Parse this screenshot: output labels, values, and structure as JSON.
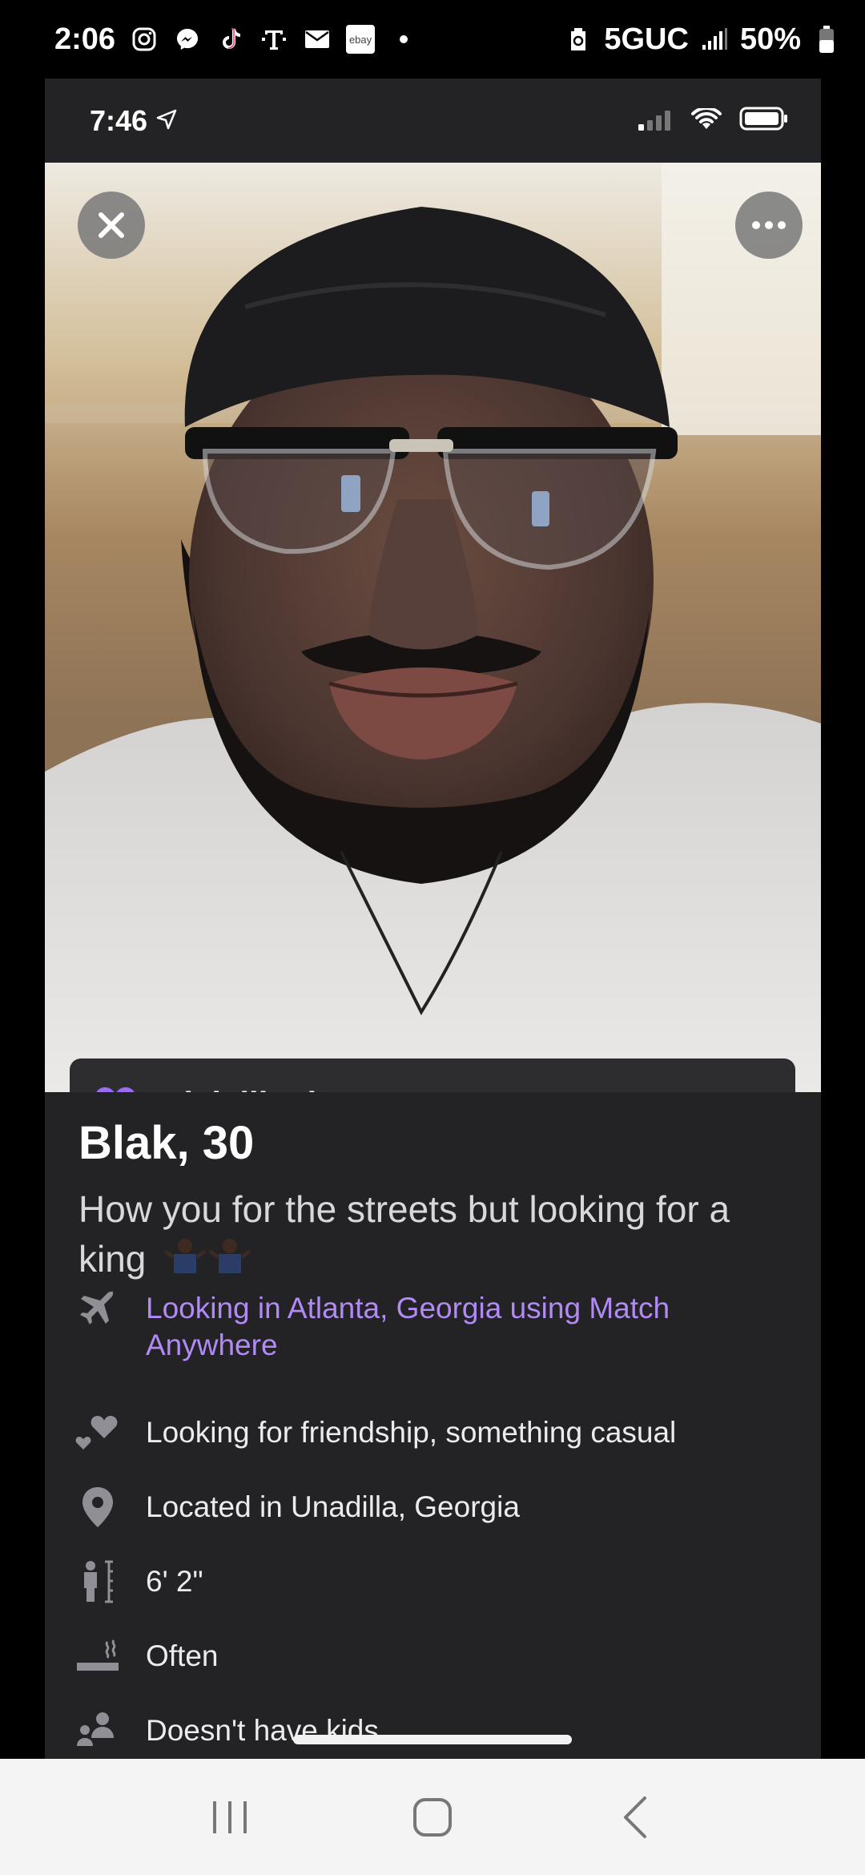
{
  "android_status": {
    "time": "2:06",
    "network": "5GUC",
    "battery": "50%",
    "notification_icons": [
      "instagram-icon",
      "messenger-icon",
      "tiktok-icon",
      "tmobile-icon",
      "mail-icon",
      "ebay-icon",
      "dot-icon"
    ],
    "ebay_label": "ebay"
  },
  "ios_status": {
    "time": "7:46"
  },
  "photo": {
    "liked_banner": "Blak liked you",
    "accent_color": "#9b6cf0"
  },
  "profile": {
    "name_age": "Blak, 30",
    "tagline": "How you for the streets but looking for a king",
    "tagline_emoji": "🤷🏿‍♂️ 🤷🏿‍♂️",
    "details": [
      {
        "icon": "airplane-icon",
        "text": "Looking in Atlanta, Georgia using Match Anywhere",
        "accent": true
      },
      {
        "icon": "hearts-icon",
        "text": "Looking for friendship, something casual",
        "accent": false
      },
      {
        "icon": "location-pin-icon",
        "text": "Located in Unadilla, Georgia",
        "accent": false
      },
      {
        "icon": "height-icon",
        "text": "6' 2\"",
        "accent": false
      },
      {
        "icon": "smoking-icon",
        "text": "Often",
        "accent": false
      },
      {
        "icon": "kids-icon",
        "text": "Doesn't have kids",
        "accent": false
      }
    ]
  },
  "nav_bar": {
    "buttons": [
      "recents-icon",
      "home-icon",
      "back-icon"
    ]
  }
}
